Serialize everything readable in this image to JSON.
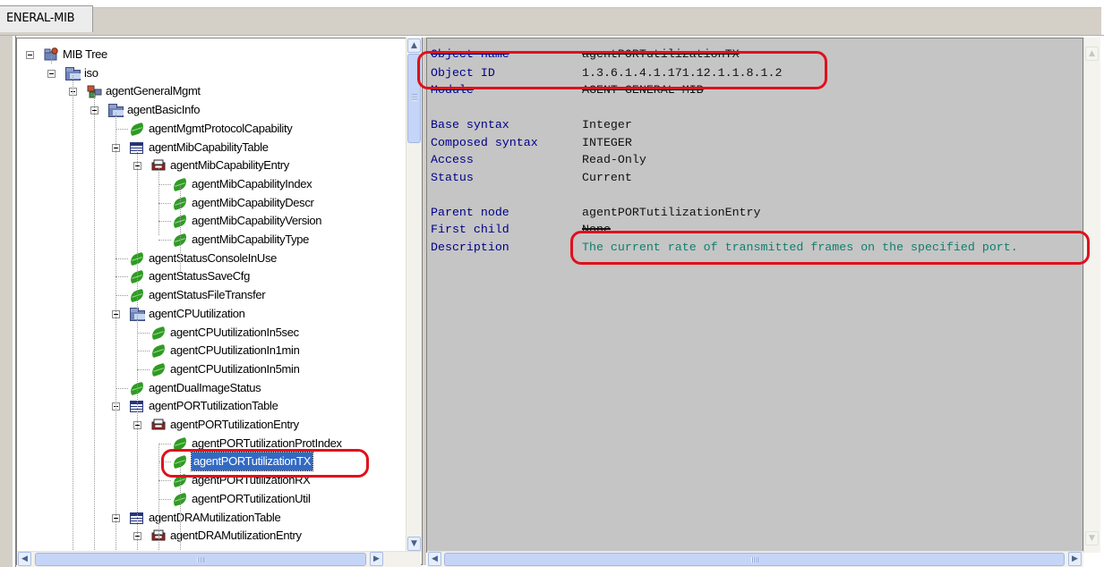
{
  "tab": {
    "label": "ENERAL-MIB"
  },
  "tree": {
    "nodes": [
      {
        "label": "MIB Tree",
        "kind": "root"
      },
      {
        "label": "iso",
        "kind": "folder"
      },
      {
        "label": "agentGeneralMgmt",
        "kind": "module"
      },
      {
        "label": "agentBasicInfo",
        "kind": "folder"
      },
      {
        "label": "agentMgmtProtocolCapability",
        "kind": "leaf"
      },
      {
        "label": "agentMibCapabilityTable",
        "kind": "table"
      },
      {
        "label": "agentMibCapabilityEntry",
        "kind": "entry"
      },
      {
        "label": "agentMibCapabilityIndex",
        "kind": "leaf"
      },
      {
        "label": "agentMibCapabilityDescr",
        "kind": "leaf"
      },
      {
        "label": "agentMibCapabilityVersion",
        "kind": "leaf"
      },
      {
        "label": "agentMibCapabilityType",
        "kind": "leaf"
      },
      {
        "label": "agentStatusConsoleInUse",
        "kind": "leaf"
      },
      {
        "label": "agentStatusSaveCfg",
        "kind": "leaf"
      },
      {
        "label": "agentStatusFileTransfer",
        "kind": "leaf"
      },
      {
        "label": "agentCPUutilization",
        "kind": "folder"
      },
      {
        "label": "agentCPUutilizationIn5sec",
        "kind": "leaf"
      },
      {
        "label": "agentCPUutilizationIn1min",
        "kind": "leaf"
      },
      {
        "label": "agentCPUutilizationIn5min",
        "kind": "leaf"
      },
      {
        "label": "agentDualImageStatus",
        "kind": "leaf"
      },
      {
        "label": "agentPORTutilizationTable",
        "kind": "table"
      },
      {
        "label": "agentPORTutilizationEntry",
        "kind": "entry"
      },
      {
        "label": "agentPORTutilizationProtIndex",
        "kind": "leaf"
      },
      {
        "label": "agentPORTutilizationTX",
        "kind": "leaf",
        "selected": true
      },
      {
        "label": "agentPORTutilizationRX",
        "kind": "leaf"
      },
      {
        "label": "agentPORTutilizationUtil",
        "kind": "leaf"
      },
      {
        "label": "agentDRAMutilizationTable",
        "kind": "table"
      },
      {
        "label": "agentDRAMutilizationEntry",
        "kind": "entry"
      }
    ]
  },
  "details": {
    "object_name": {
      "label": "Object name",
      "value": "agentPORTutilizationTX"
    },
    "object_id": {
      "label": "Object ID",
      "value": "1.3.6.1.4.1.171.12.1.1.8.1.2"
    },
    "module": {
      "label": "Module",
      "value": "AGENT-GENERAL-MIB"
    },
    "base_syntax": {
      "label": "Base syntax",
      "value": "Integer"
    },
    "composed_syntax": {
      "label": "Composed syntax",
      "value": "INTEGER"
    },
    "access": {
      "label": "Access",
      "value": "Read-Only"
    },
    "status": {
      "label": "Status",
      "value": "Current"
    },
    "parent_node": {
      "label": "Parent node",
      "value": "agentPORTutilizationEntry"
    },
    "first_child": {
      "label": "First child",
      "value": "None"
    },
    "description": {
      "label": "Description",
      "value": "The current rate of transmitted frames on the specified port."
    }
  },
  "colors": {
    "highlight": "#e0101c",
    "detail_background": "#c5c5c5",
    "label_text": "#000088",
    "description_text": "#0f7f6e",
    "selection": "#316ac5"
  }
}
